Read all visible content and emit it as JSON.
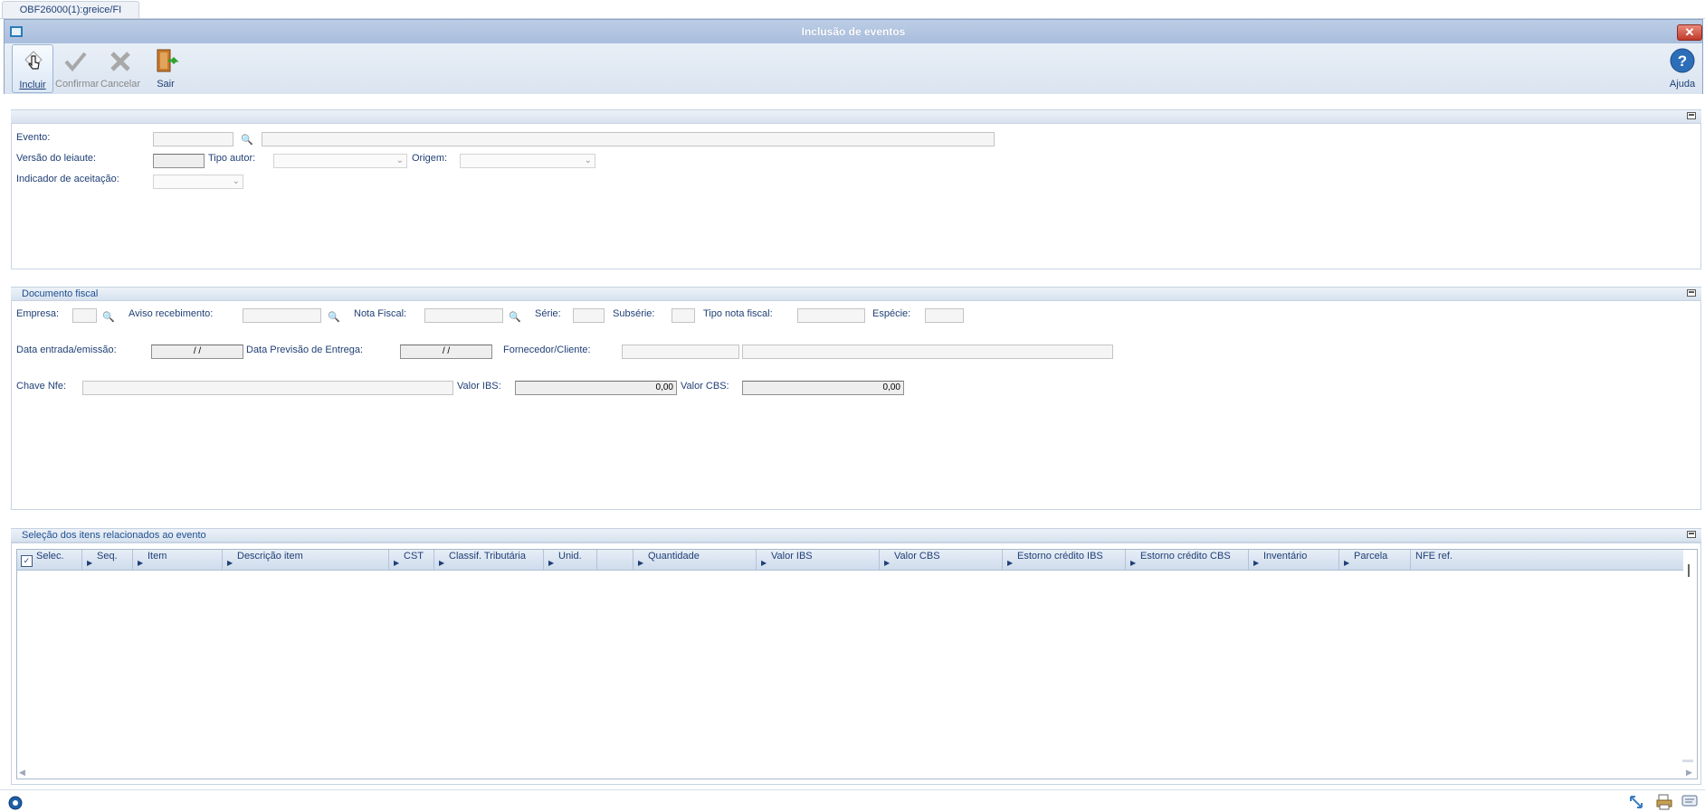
{
  "tab": {
    "label": "OBF26000(1):greice/FI"
  },
  "window": {
    "title": "Inclusão de eventos",
    "close": "✕"
  },
  "toolbar": {
    "incluir": "Incluir",
    "confirmar": "Confirmar",
    "cancelar": "Cancelar",
    "sair": "Sair",
    "ajuda": "Ajuda"
  },
  "evento_section": {
    "evento_label": "Evento:",
    "versao_label": "Versão do leiaute:",
    "tipo_autor_label": "Tipo autor:",
    "origem_label": "Origem:",
    "indicador_label": "Indicador de aceitação:"
  },
  "documento_section": {
    "title": "Documento fiscal",
    "empresa_label": "Empresa:",
    "aviso_label": "Aviso recebimento:",
    "nota_label": "Nota Fiscal:",
    "serie_label": "Série:",
    "subserie_label": "Subsérie:",
    "tipo_nota_label": "Tipo nota fiscal:",
    "especie_label": "Espécie:",
    "data_entrada_label": "Data entrada/emissão:",
    "data_entrada_value": " / /",
    "data_previsao_label": "Data Previsão de Entrega:",
    "data_previsao_value": " / /",
    "fornecedor_label": "Fornecedor/Cliente:",
    "chave_label": "Chave Nfe:",
    "valor_ibs_label": "Valor IBS:",
    "valor_ibs_value": "0,00",
    "valor_cbs_label": "Valor CBS:",
    "valor_cbs_value": "0,00"
  },
  "itens_section": {
    "title": "Seleção dos itens relacionados ao evento",
    "columns": [
      "Selec.",
      "Seq.",
      "Item",
      "Descrição item",
      "CST",
      "Classif. Tributária",
      "Unid.",
      "",
      "Quantidade",
      "Valor IBS",
      "Valor CBS",
      "Estorno crédito IBS",
      "Estorno crédito CBS",
      "Inventário",
      "Parcela",
      "NFE ref."
    ]
  },
  "icons": {
    "incluir": "pointer-hand-icon",
    "confirmar": "check-icon",
    "cancelar": "x-icon",
    "sair": "exit-door-icon",
    "ajuda": "help-icon"
  },
  "colors": {
    "accent": "#1f4f8f",
    "titlebar": "#a9bedd",
    "close": "#c0392b"
  }
}
